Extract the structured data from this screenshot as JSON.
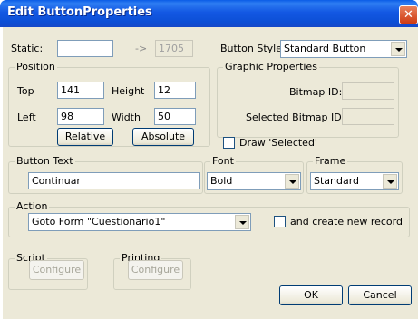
{
  "window": {
    "title": "Edit ButtonProperties",
    "close_glyph": "✕"
  },
  "static": {
    "label": "Static:",
    "value": "",
    "arrow": "->",
    "id_value": "1705"
  },
  "button_style": {
    "label": "Button Style:",
    "selected": "Standard Button"
  },
  "position": {
    "group_label": "Position",
    "top_label": "Top",
    "top_value": "141",
    "height_label": "Height",
    "height_value": "12",
    "left_label": "Left",
    "left_value": "98",
    "width_label": "Width",
    "width_value": "50",
    "relative_label": "Relative",
    "absolute_label": "Absolute"
  },
  "graphic": {
    "group_label": "Graphic Properties",
    "bitmap_label": "Bitmap ID:",
    "bitmap_value": "",
    "selected_bitmap_label": "Selected Bitmap ID:",
    "selected_bitmap_value": ""
  },
  "draw_selected": {
    "label": "Draw 'Selected'",
    "checked": false
  },
  "button_text": {
    "group_label": "Button Text",
    "value": "Continuar"
  },
  "font": {
    "group_label": "Font",
    "selected": "Bold"
  },
  "frame": {
    "group_label": "Frame",
    "selected": "Standard"
  },
  "action": {
    "group_label": "Action",
    "selected": "Goto Form \"Cuestionario1\"",
    "create_record_label": "and create new record",
    "create_record_checked": false
  },
  "script": {
    "group_label": "Script",
    "configure_label": "Configure"
  },
  "printing": {
    "group_label": "Printing",
    "configure_label": "Configure"
  },
  "footer": {
    "ok_label": "OK",
    "cancel_label": "Cancel"
  },
  "colors": {
    "titlebar": "#0c4fd6",
    "dialog_bg": "#ece9d8",
    "close": "#cf3b12"
  }
}
